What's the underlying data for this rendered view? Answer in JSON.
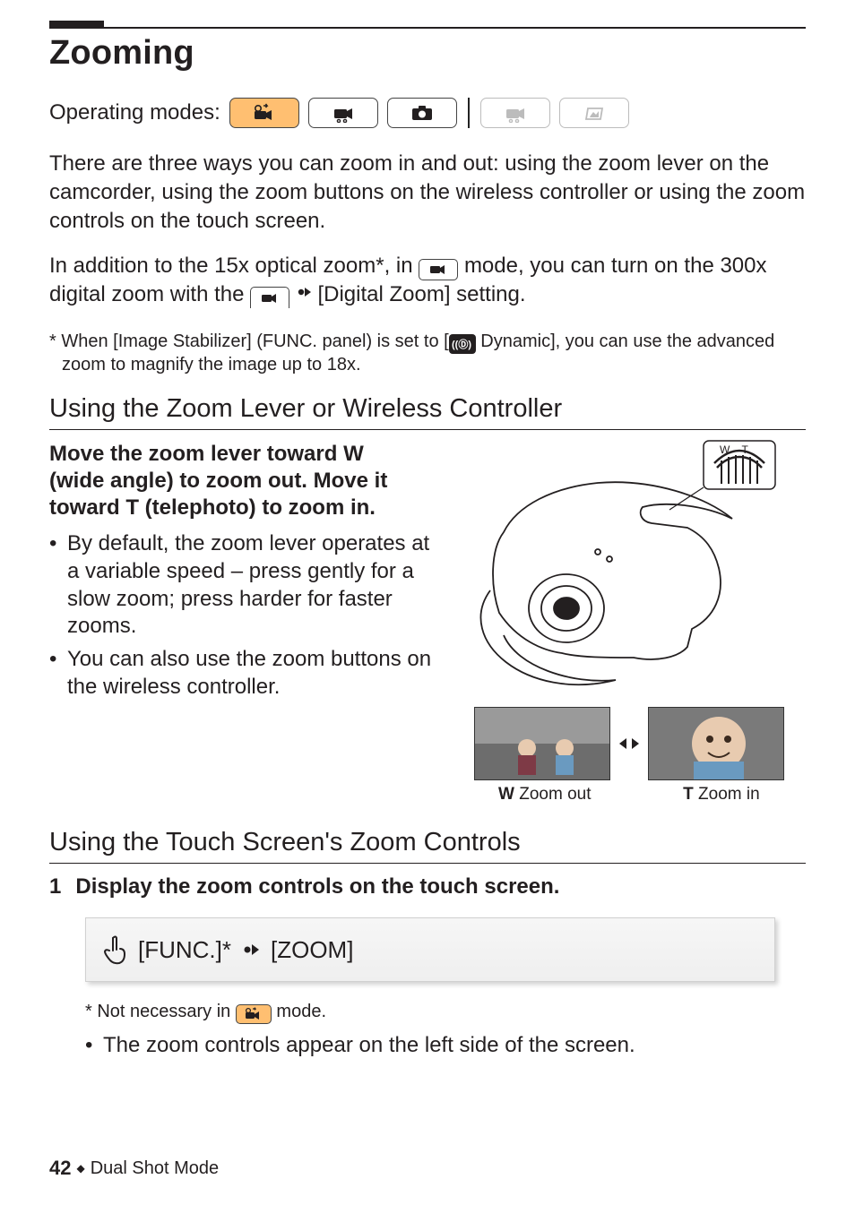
{
  "section": {
    "title": "Zooming",
    "operating_modes_label": "Operating modes:"
  },
  "modes": {
    "auto": {
      "name": "auto-mode"
    },
    "manual_video": {
      "name": "manual-video-mode"
    },
    "manual_photo": {
      "name": "manual-photo-mode"
    },
    "playback_video": {
      "name": "playback-video-mode"
    },
    "playback_photo": {
      "name": "playback-photo-mode"
    }
  },
  "intro": {
    "p1": "There are three ways you can zoom in and out: using the zoom lever on the camcorder, using the zoom buttons on the wireless controller or using the zoom controls on the touch screen.",
    "p2_pre": "In addition to the 15x optical zoom*, in ",
    "p2_mid": " mode, you can turn on the 300x digital zoom with the ",
    "p2_post": " [Digital Zoom] setting.",
    "note_pre": "* When [Image Stabilizer] (FUNC. panel) is set to [",
    "note_label": " Dynamic], you can use the advanced zoom to magnify the image up to 18x."
  },
  "sub1": {
    "heading": "Using the Zoom Lever or Wireless Controller",
    "instr_line1_pre": "Move the zoom lever toward ",
    "instr_line1_glyph": "W",
    "instr_line2": "(wide angle) to zoom out. Move it",
    "instr_line3_pre": "toward ",
    "instr_line3_glyph": "T",
    "instr_line3_post": " (telephoto) to zoom in.",
    "bullet1": "By default, the zoom lever operates at a variable speed – press gently for a slow zoom; press harder for faster zooms.",
    "bullet2": "You can also use the zoom buttons on the wireless controller.",
    "wt_label": "W – T",
    "cap_w_glyph": "W",
    "cap_w_text": " Zoom out",
    "cap_t_glyph": "T",
    "cap_t_text": " Zoom in"
  },
  "sub2": {
    "heading": "Using the Touch Screen's Zoom Controls",
    "step_num": "1",
    "step_text": "Display the zoom controls on the touch screen.",
    "func_label": "[FUNC.]*",
    "zoom_label": "[ZOOM]",
    "footnote_pre": "* Not necessary in ",
    "footnote_post": " mode.",
    "result": "The zoom controls appear on the left side of the screen."
  },
  "footer": {
    "page": "42",
    "chapter": "Dual Shot Mode"
  }
}
